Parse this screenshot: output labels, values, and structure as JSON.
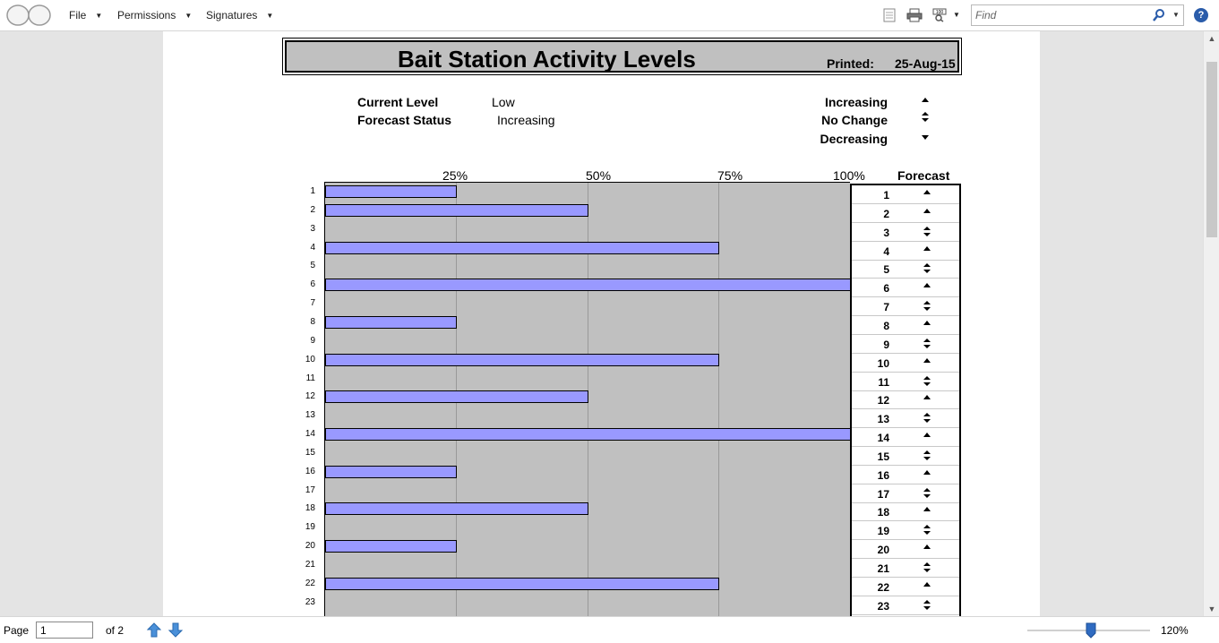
{
  "toolbar": {
    "menus": [
      {
        "label": "File"
      },
      {
        "label": "Permissions"
      },
      {
        "label": "Signatures"
      }
    ],
    "find_placeholder": "Find",
    "help_label": "?"
  },
  "report": {
    "title": "Bait Station Activity Levels",
    "printed_label": "Printed:",
    "printed_date": "25-Aug-15",
    "current_level_label": "Current Level",
    "current_level_value": "Low",
    "forecast_status_label": "Forecast Status",
    "forecast_status_value": "Increasing",
    "legend": [
      {
        "label": "Increasing",
        "symbol": "up"
      },
      {
        "label": "No Change",
        "symbol": "updown"
      },
      {
        "label": "Decreasing",
        "symbol": "down"
      }
    ],
    "forecast_header": "Forecast"
  },
  "chart_data": {
    "type": "bar",
    "orientation": "horizontal",
    "xlim": [
      0,
      100
    ],
    "x_ticks": [
      "25%",
      "50%",
      "75%",
      "100%"
    ],
    "categories": [
      "1",
      "2",
      "3",
      "4",
      "5",
      "6",
      "7",
      "8",
      "9",
      "10",
      "11",
      "12",
      "13",
      "14",
      "15",
      "16",
      "17",
      "18",
      "19",
      "20",
      "21",
      "22",
      "23"
    ],
    "values": [
      25,
      50,
      0,
      75,
      0,
      100,
      0,
      25,
      0,
      75,
      0,
      50,
      0,
      100,
      0,
      25,
      0,
      50,
      0,
      25,
      0,
      75,
      0
    ],
    "grid": true,
    "forecast": [
      "up",
      "up",
      "updown",
      "up",
      "updown",
      "up",
      "updown",
      "up",
      "updown",
      "up",
      "updown",
      "up",
      "updown",
      "up",
      "updown",
      "up",
      "updown",
      "up",
      "updown",
      "up",
      "updown",
      "up",
      "updown"
    ],
    "colors": {
      "bar": "#9999ff",
      "plot_bg": "#c0c0c0"
    }
  },
  "statusbar": {
    "page_label": "Page",
    "page_value": "1",
    "of_label": "of 2",
    "zoom": "120%"
  }
}
